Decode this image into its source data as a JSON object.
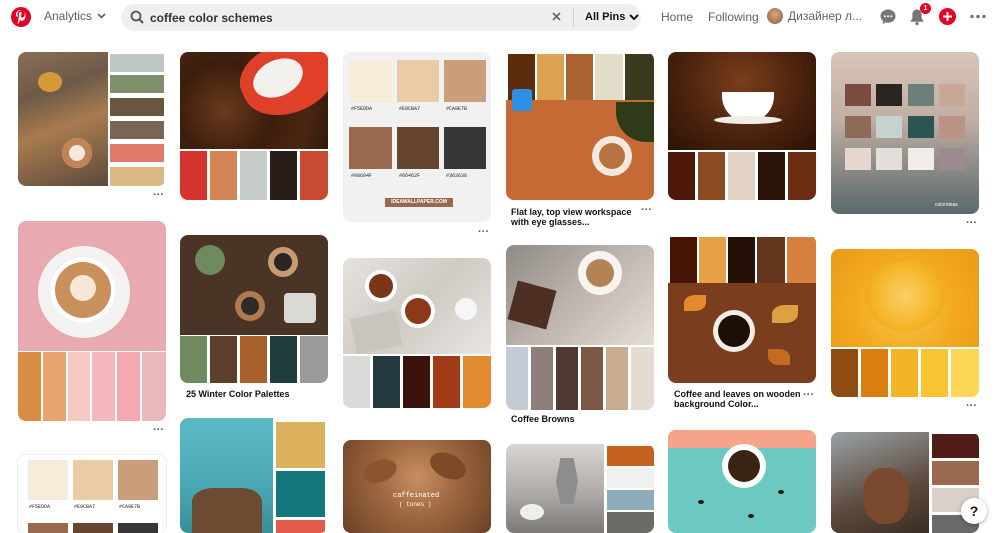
{
  "header": {
    "analytics_label": "Analytics",
    "search_query": "coffee color schemes",
    "filter_label": "All Pins",
    "nav_home": "Home",
    "nav_following": "Following",
    "user_name": "Дизайнер л...",
    "notification_count": "1",
    "help_label": "?"
  },
  "pins": {
    "p3": {
      "hex": [
        "#F5EDDA",
        "#E9CBA7",
        "#CA9E7B",
        "#98694F",
        "#66462F",
        "#363636"
      ],
      "footer": "IDEAWALLPAPER.COM"
    },
    "p4": {
      "hex": [
        "#5C2C0C",
        "#DDA352",
        "#AA6231",
        "#E3DECA",
        "#3C3A1E"
      ],
      "caption": "Flat lay, top view workspace with eye glasses..."
    },
    "p5": {
      "hex": [
        "#461304",
        "#E5A048",
        "#260F07",
        "#6436C1C",
        "#D6813B"
      ],
      "caption": "Coffee and leaves on wooden background Color..."
    },
    "p6": {
      "brand": "colorideas"
    },
    "p8": {
      "caption": "25 Winter Color Palettes"
    },
    "p9": {
      "caption": "Coffee Browns"
    },
    "p10": {
      "overlay1": "caffeinated",
      "overlay2": "( tones )"
    },
    "p11": {
      "hex": [
        "#F5EDDA",
        "#E9CBA7",
        "#CA9E7B"
      ]
    }
  },
  "colors": {
    "brand_red": "#e60023"
  }
}
